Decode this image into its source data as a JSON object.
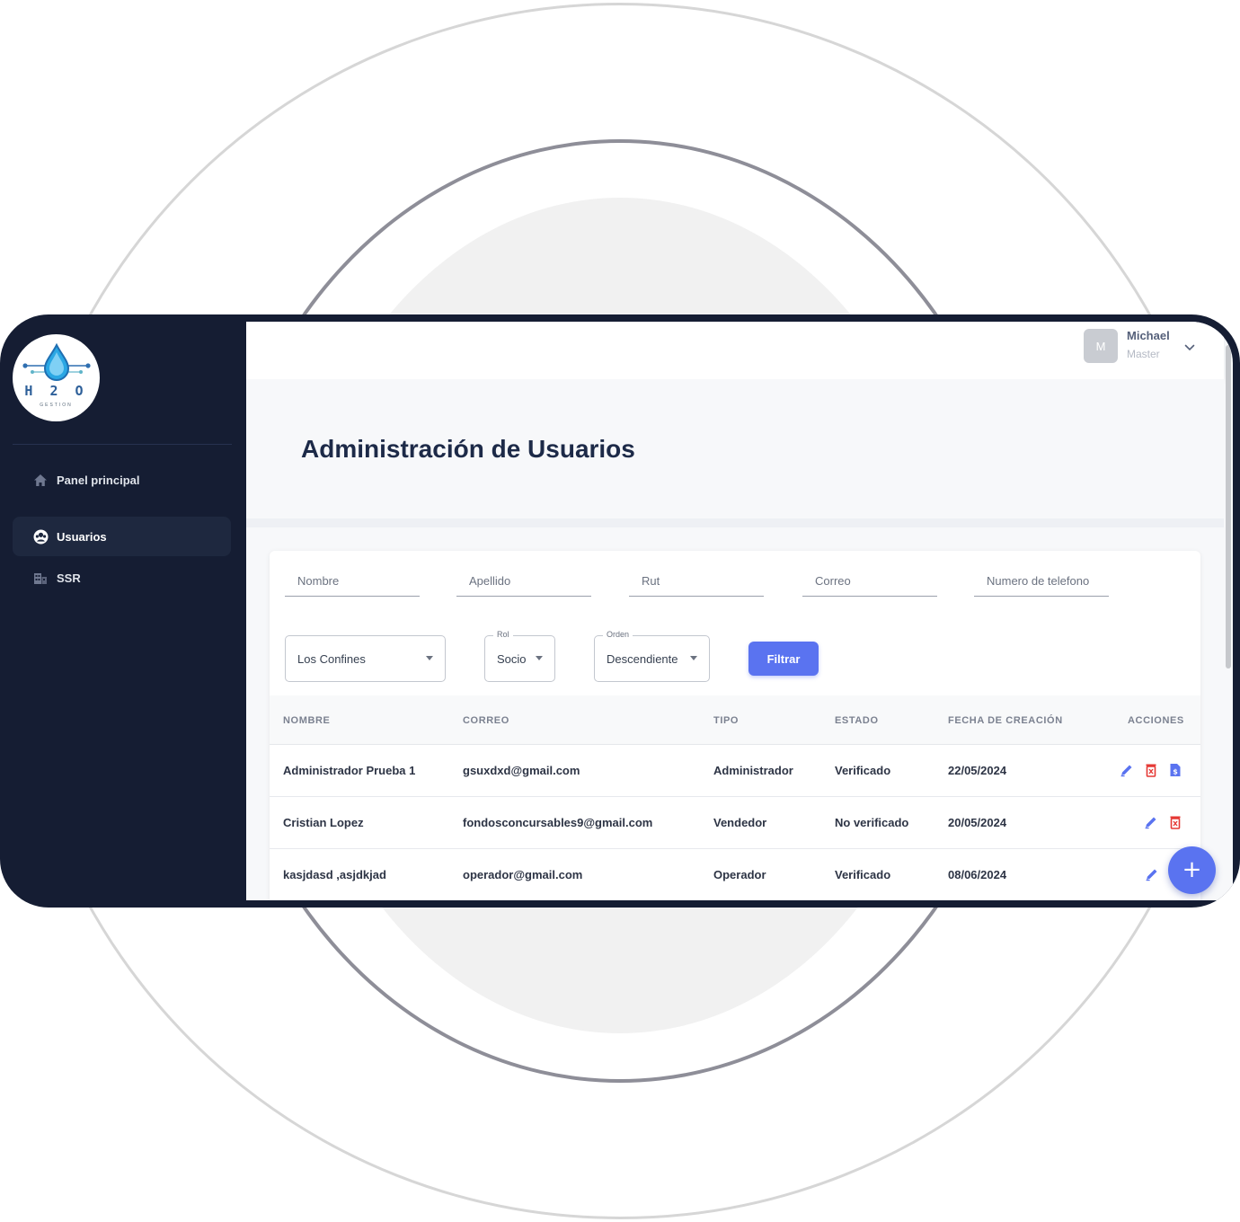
{
  "brand": {
    "logo_text": "H 2 O",
    "logo_sub": "GESTION"
  },
  "sidebar": {
    "items": [
      {
        "label": "Panel principal",
        "icon": "home-icon",
        "active": false
      },
      {
        "label": "Usuarios",
        "icon": "users-icon",
        "active": true
      },
      {
        "label": "SSR",
        "icon": "building-icon",
        "active": false
      }
    ]
  },
  "header": {
    "avatar_initial": "M",
    "user_name": "Michael",
    "user_role": "Master"
  },
  "page": {
    "title": "Administración de Usuarios"
  },
  "filters": {
    "nombre_placeholder": "Nombre",
    "apellido_placeholder": "Apellido",
    "rut_placeholder": "Rut",
    "correo_placeholder": "Correo",
    "telefono_placeholder": "Numero de telefono",
    "ssr_value": "Los Confines",
    "rol_label": "Rol",
    "rol_value": "Socio",
    "orden_label": "Orden",
    "orden_value": "Descendiente",
    "filter_button": "Filtrar"
  },
  "table": {
    "headers": {
      "nombre": "NOMBRE",
      "correo": "CORREO",
      "tipo": "TIPO",
      "estado": "ESTADO",
      "fecha": "FECHA DE CREACIÓN",
      "acciones": "ACCIONES"
    },
    "rows": [
      {
        "nombre": "Administrador Prueba 1",
        "correo": "gsuxdxd@gmail.com",
        "tipo": "Administrador",
        "estado": "Verificado",
        "fecha": "22/05/2024"
      },
      {
        "nombre": "Cristian Lopez",
        "correo": "fondosconcursables9@gmail.com",
        "tipo": "Vendedor",
        "estado": "No verificado",
        "fecha": "20/05/2024"
      },
      {
        "nombre": "kasjdasd ,asjdkjad",
        "correo": "operador@gmail.com",
        "tipo": "Operador",
        "estado": "Verificado",
        "fecha": "08/06/2024"
      }
    ]
  },
  "fab": {
    "label": "+"
  },
  "colors": {
    "sidebar": "#151d33",
    "accent": "#5a73f0",
    "danger": "#e53935",
    "title": "#1d2a48"
  }
}
